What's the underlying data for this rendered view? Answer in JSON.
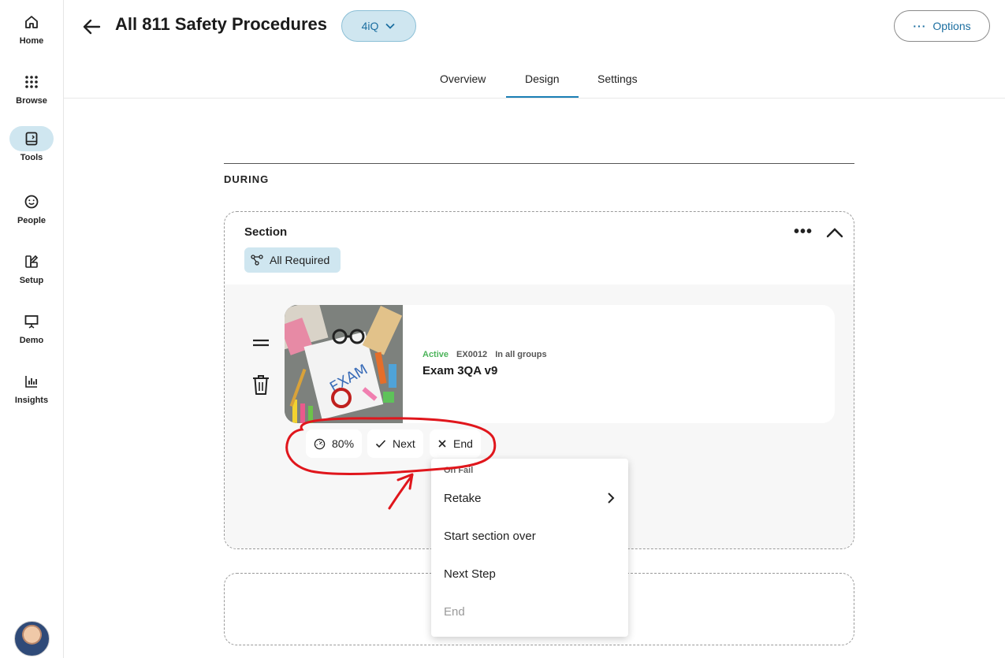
{
  "sidebar": {
    "items": [
      {
        "label": "Home",
        "icon": "home-icon"
      },
      {
        "label": "Browse",
        "icon": "grid-icon"
      },
      {
        "label": "Tools",
        "icon": "tools-icon",
        "active": true
      },
      {
        "label": "People",
        "icon": "smiley-icon"
      },
      {
        "label": "Setup",
        "icon": "setup-icon"
      },
      {
        "label": "Demo",
        "icon": "presentation-icon"
      },
      {
        "label": "Insights",
        "icon": "bar-chart-icon"
      }
    ]
  },
  "header": {
    "title": "All 811 Safety Procedures",
    "badge": "4iQ",
    "options_label": "Options"
  },
  "tabs": [
    {
      "label": "Overview"
    },
    {
      "label": "Design",
      "active": true
    },
    {
      "label": "Settings"
    }
  ],
  "content": {
    "phase_label": "DURING",
    "section": {
      "title": "Section",
      "requirement": "All Required",
      "item": {
        "status": "Active",
        "code": "EX0012",
        "groups": "In all groups",
        "title": "Exam 3QA v9"
      },
      "rules": {
        "score": "80%",
        "pass_label": "Next",
        "fail_label": "End"
      }
    }
  },
  "dropdown": {
    "header": "On Fail",
    "items": [
      {
        "label": "Retake",
        "has_submenu": true
      },
      {
        "label": "Start section over"
      },
      {
        "label": "Next Step"
      },
      {
        "label": "End",
        "disabled": true
      }
    ]
  },
  "colors": {
    "accent": "#1b7fb5",
    "badge_bg": "#cfe6f0",
    "active_status": "#4cb45a",
    "annotation": "#e0161c"
  }
}
